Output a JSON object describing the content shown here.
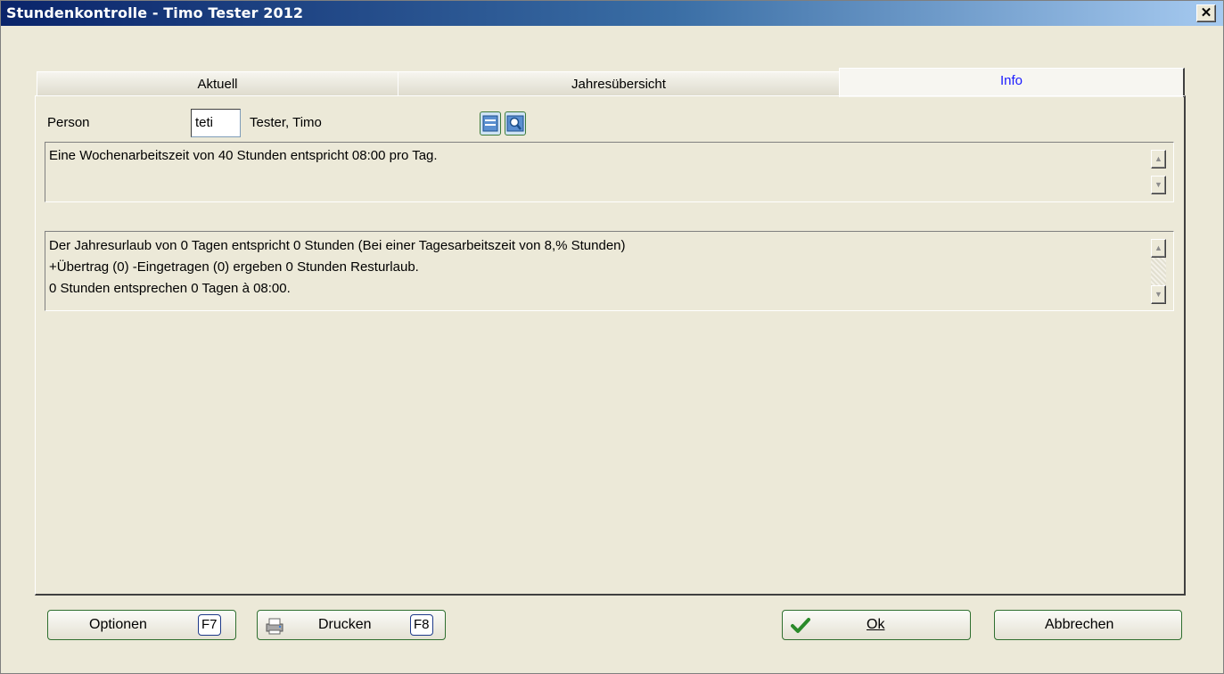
{
  "window": {
    "title": "Stundenkontrolle - Timo Tester 2012",
    "close_label": "✕"
  },
  "tabs": [
    {
      "label": "Aktuell"
    },
    {
      "label": "Jahresübersicht"
    },
    {
      "label": "Info"
    }
  ],
  "person": {
    "label": "Person",
    "code": "teti",
    "name": "Tester, Timo"
  },
  "icons": {
    "edit": "edit-icon",
    "search": "search-icon"
  },
  "info_box1": {
    "line1": "Eine Wochenarbeitszeit von 40 Stunden entspricht 08:00 pro Tag."
  },
  "info_box2": {
    "line1": "Der Jahresurlaub von 0 Tagen entspricht 0 Stunden (Bei einer Tagesarbeitszeit von 8,% Stunden)",
    "line2": "+Übertrag (0) -Eingetragen (0) ergeben 0 Stunden Resturlaub.",
    "line3": "0 Stunden entsprechen 0 Tagen à 08:00."
  },
  "buttons": {
    "optionen": {
      "label": "Optionen",
      "key": "F7"
    },
    "drucken": {
      "label": "Drucken",
      "key": "F8"
    },
    "ok": {
      "label": "Ok"
    },
    "abbrechen": {
      "label": "Abbrechen"
    }
  },
  "colors": {
    "title_bar_start": "#0a246a",
    "active_tab_text": "#1a1aff",
    "window_bg": "#ece9d8"
  }
}
